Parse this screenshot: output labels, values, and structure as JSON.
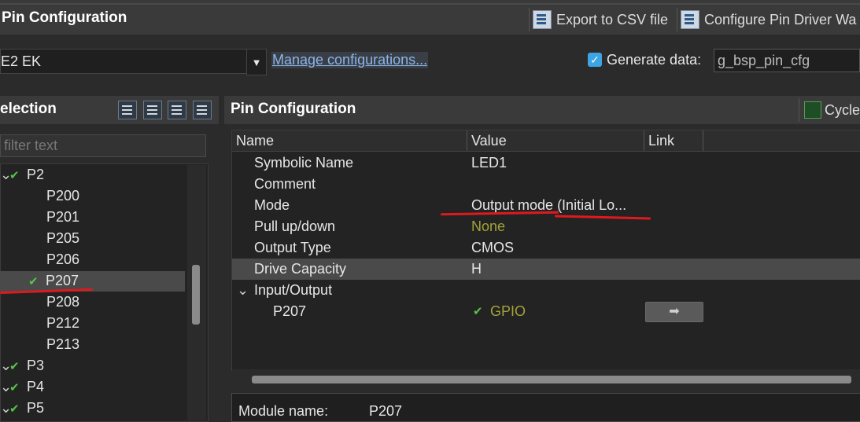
{
  "header": {
    "title": "Pin Configuration",
    "export_label": "Export to CSV file",
    "configure_label": "Configure Pin Driver Wa"
  },
  "config": {
    "selected": "E2 EK",
    "dropdown_arrow": "▼",
    "manage_link": "Manage configurations...",
    "generate_checked": true,
    "generate_label": "Generate data:",
    "generate_value": "g_bsp_pin_cfg"
  },
  "left_panel": {
    "title": "election",
    "filter_placeholder": "filter text",
    "tree": [
      {
        "label": "P2",
        "checked": true,
        "level": 0
      },
      {
        "label": "P200",
        "checked": false,
        "level": 1
      },
      {
        "label": "P201",
        "checked": false,
        "level": 1
      },
      {
        "label": "P205",
        "checked": false,
        "level": 1
      },
      {
        "label": "P206",
        "checked": false,
        "level": 1
      },
      {
        "label": "P207",
        "checked": true,
        "level": 1,
        "selected": true
      },
      {
        "label": "P208",
        "checked": false,
        "level": 1
      },
      {
        "label": "P212",
        "checked": false,
        "level": 1
      },
      {
        "label": "P213",
        "checked": false,
        "level": 1
      },
      {
        "label": "P3",
        "checked": true,
        "level": 0
      },
      {
        "label": "P4",
        "checked": true,
        "level": 0
      },
      {
        "label": "P5",
        "checked": true,
        "level": 0
      }
    ]
  },
  "right_panel": {
    "title": "Pin Configuration",
    "cycle_label": "Cycle",
    "columns": [
      "Name",
      "Value",
      "Link"
    ],
    "rows": [
      {
        "name": "Symbolic Name",
        "value": "LED1"
      },
      {
        "name": "Comment",
        "value": ""
      },
      {
        "name": "Mode",
        "value": "Output mode (Initial Lo..."
      },
      {
        "name": "Pull up/down",
        "value": "None"
      },
      {
        "name": "Output Type",
        "value": "CMOS"
      },
      {
        "name": "Drive Capacity",
        "value": "H"
      },
      {
        "name": "Input/Output",
        "value": ""
      },
      {
        "name": "P207",
        "value": "GPIO"
      }
    ],
    "goto_glyph": "➡",
    "module_label": "Module name:",
    "module_value": "P207"
  },
  "colors": {
    "accent": "#3da5e6",
    "check_green": "#59c24b",
    "olive_text": "#a3a23a",
    "annotation_red": "#e0191e"
  }
}
